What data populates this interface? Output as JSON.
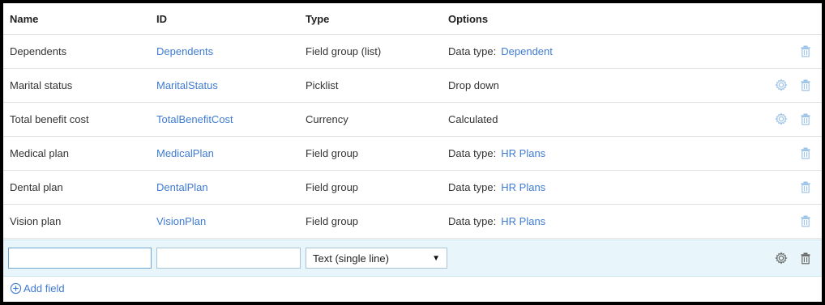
{
  "columns": {
    "name": "Name",
    "id": "ID",
    "type": "Type",
    "options": "Options"
  },
  "rows": [
    {
      "name": "Dependents",
      "id": "Dependents",
      "type": "Field group (list)",
      "opt_label": "Data type:",
      "opt_link": "Dependent",
      "opt_text": "",
      "has_gear": false
    },
    {
      "name": "Marital status",
      "id": "MaritalStatus",
      "type": "Picklist",
      "opt_label": "",
      "opt_link": "",
      "opt_text": "Drop down",
      "has_gear": true
    },
    {
      "name": "Total benefit cost",
      "id": "TotalBenefitCost",
      "type": "Currency",
      "opt_label": "",
      "opt_link": "",
      "opt_text": "Calculated",
      "has_gear": true
    },
    {
      "name": "Medical plan",
      "id": "MedicalPlan",
      "type": "Field group",
      "opt_label": "Data type:",
      "opt_link": "HR Plans",
      "opt_text": "",
      "has_gear": false
    },
    {
      "name": "Dental plan",
      "id": "DentalPlan",
      "type": "Field group",
      "opt_label": "Data type:",
      "opt_link": "HR Plans",
      "opt_text": "",
      "has_gear": false
    },
    {
      "name": "Vision plan",
      "id": "VisionPlan",
      "type": "Field group",
      "opt_label": "Data type:",
      "opt_link": "HR Plans",
      "opt_text": "",
      "has_gear": false
    }
  ],
  "new_field": {
    "name_value": "",
    "id_value": "",
    "type_selected": "Text (single line)"
  },
  "add_field_label": "Add field",
  "icons": {
    "delete": "trash-icon",
    "settings": "gear-icon",
    "add": "plus-circle-icon",
    "dropdown": "caret-down-icon"
  },
  "colors": {
    "link": "#3f7bd3",
    "icon_light": "#9cc3e8",
    "icon_dark": "#666666",
    "new_row_bg": "#e8f6fb"
  }
}
